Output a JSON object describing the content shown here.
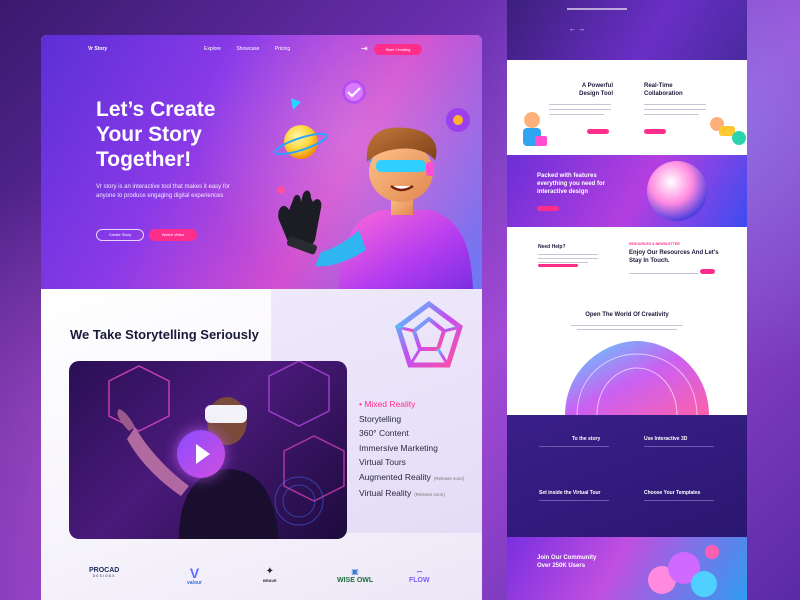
{
  "nav": {
    "logo": "Vr Story",
    "links": [
      "Explore",
      "Showcase",
      "Pricing"
    ],
    "login_icon": "login-icon",
    "start_label": "Start Creating"
  },
  "hero": {
    "title_lines": [
      "Let’s Create",
      "Your Story",
      "Together!"
    ],
    "description": "Vr story is an interactive tool that makes it easy for anyone to produce engaging digital experiences",
    "btn_outline": "Create Story",
    "btn_pink": "Watch Video"
  },
  "section2": {
    "title": "We Take Storytelling Seriously",
    "features": [
      {
        "label": "Mixed Reality",
        "tag": "",
        "active": true
      },
      {
        "label": "Storytelling",
        "tag": "",
        "active": false
      },
      {
        "label": "360° Content",
        "tag": "",
        "active": false
      },
      {
        "label": "Immersive Marketing",
        "tag": "",
        "active": false
      },
      {
        "label": "Virtual Tours",
        "tag": "",
        "active": false
      },
      {
        "label": "Augmented Reality",
        "tag": "(Release soon)",
        "active": false
      },
      {
        "label": "Virtual Reality",
        "tag": "(Release soon)",
        "active": false
      }
    ]
  },
  "logos": [
    {
      "name": "PROCAD",
      "sub": "DESIGNS",
      "color": "#1b2b5a"
    },
    {
      "name": "valour",
      "sub": "",
      "color": "#3b6fd6"
    },
    {
      "name": "BRAVE",
      "sub": "",
      "color": "#2a2a2a"
    },
    {
      "name": "WISE OWL",
      "sub": "",
      "color": "#1e6b3a"
    },
    {
      "name": "FLOW",
      "sub": "",
      "color": "#7a5cff"
    }
  ],
  "right": {
    "card1_title": "A Powerful Design Tool",
    "card2_title": "Real-Time Collaboration",
    "features_text": "Packed with features everything you need for interactive design",
    "need_help": "Need Help?",
    "newsletter_sub": "RESOURCES & NEWSLETTER",
    "newsletter_title": "Enjoy Our Resources And Let's Stay In Touch.",
    "open_world": "Open The World Of Creativity",
    "dark_items": [
      "To the story",
      "Use Interactive 3D",
      "Set inside the Virtual Tour",
      "Choose Your Templates"
    ],
    "community": "Join Our Community Over 250K Users"
  },
  "colors": {
    "accent_pink": "#ff2e8a",
    "purple": "#6a2fd6",
    "dark_navy": "#1a1a3a"
  }
}
